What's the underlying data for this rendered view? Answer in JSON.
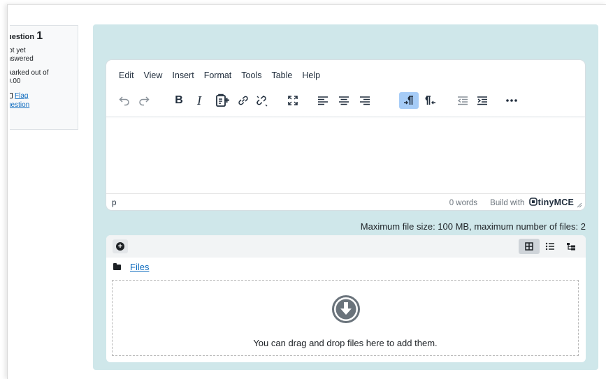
{
  "question_info": {
    "label_prefix": "uestion",
    "number": "1",
    "state_line1": "lot yet",
    "state_line2": "nswered",
    "marks_line1": "Aarked out of",
    "marks_line2": "0.00",
    "flag_line1": "Flag",
    "flag_line2": "uestion"
  },
  "editor": {
    "menu": [
      "Edit",
      "View",
      "Insert",
      "Format",
      "Tools",
      "Table",
      "Help"
    ],
    "toolbar_icons": [
      "undo-icon",
      "redo-icon",
      "bold-icon",
      "italic-icon",
      "insert-content-icon",
      "link-icon",
      "unlink-icon",
      "fullscreen-icon",
      "align-left-icon",
      "align-center-icon",
      "align-right-icon",
      "ltr-icon",
      "rtl-icon",
      "outdent-icon",
      "indent-icon",
      "more-icon"
    ],
    "bold_glyph": "B",
    "italic_glyph": "I",
    "status_path": "p",
    "word_count": "0 words",
    "brand_prefix": "Build with",
    "brand_name": "tinyMCE"
  },
  "filepicker": {
    "max_size_text": "Maximum file size: 100 MB, maximum number of files: 2",
    "path_label": "Files",
    "drop_text": "You can drag and drop files here to add them.",
    "views": [
      "grid-view-icon",
      "list-view-icon",
      "tree-view-icon"
    ],
    "selected_view": "grid-view-icon"
  },
  "colors": {
    "panel_bg": "#cfe7ea",
    "link": "#0f6cbf",
    "active_button": "#a6ccf7"
  }
}
